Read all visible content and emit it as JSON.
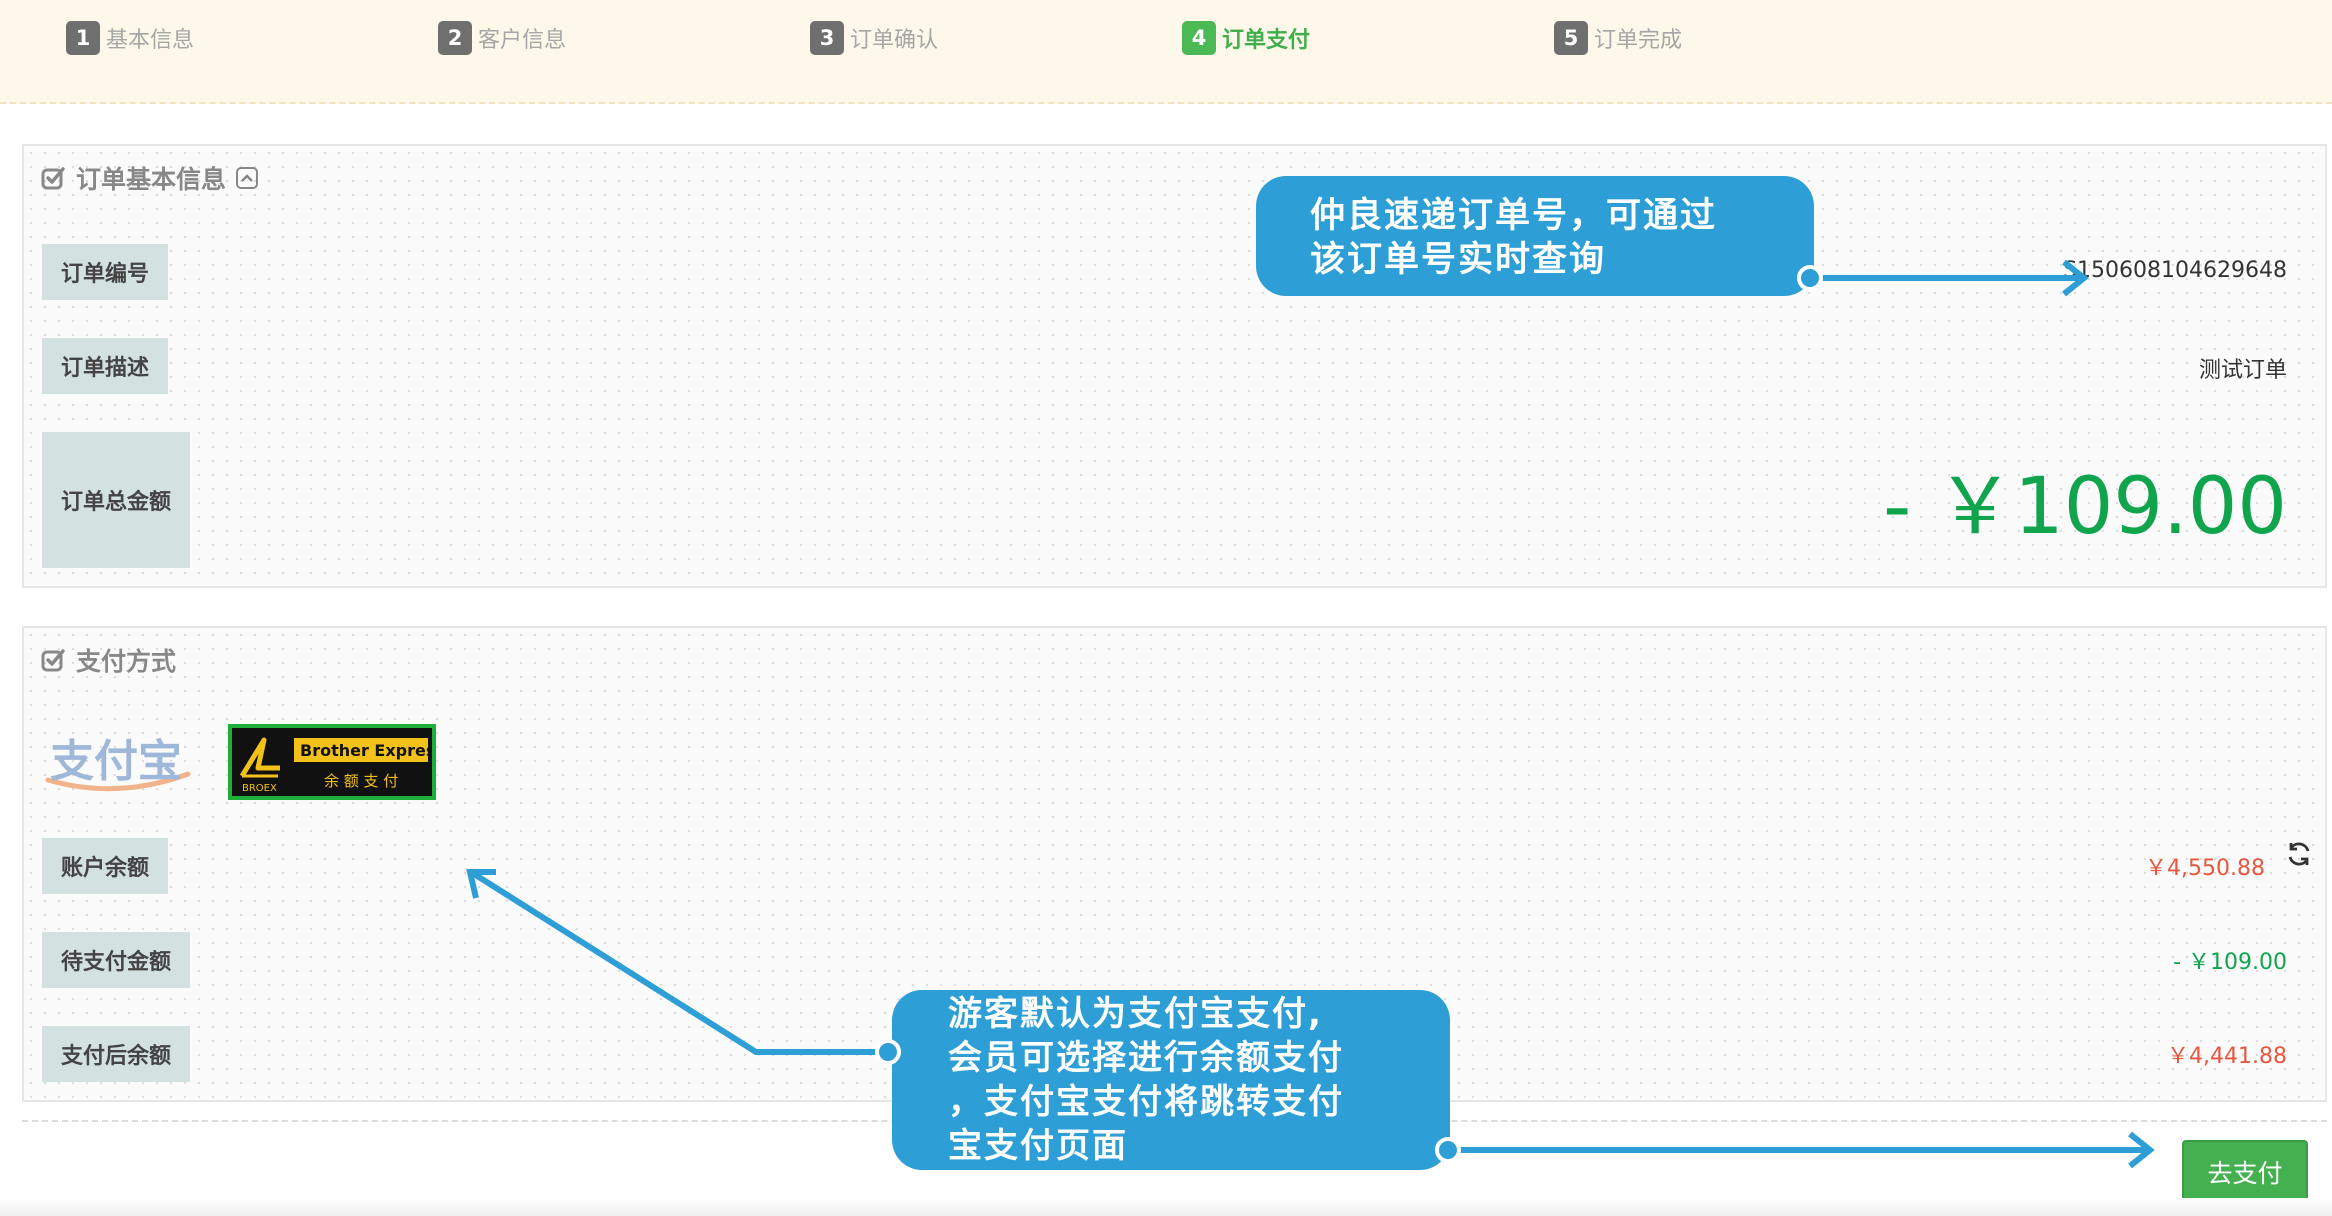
{
  "steps": [
    {
      "num": "1",
      "label": "基本信息",
      "active": false
    },
    {
      "num": "2",
      "label": "客户信息",
      "active": false
    },
    {
      "num": "3",
      "label": "订单确认",
      "active": false
    },
    {
      "num": "4",
      "label": "订单支付",
      "active": true
    },
    {
      "num": "5",
      "label": "订单完成",
      "active": false
    }
  ],
  "order_info": {
    "title": "订单基本信息",
    "order_no_label": "订单编号",
    "order_no": "S150608104629648",
    "desc_label": "订单描述",
    "desc": "测试订单",
    "total_label": "订单总金额",
    "total": "- ￥109.00"
  },
  "payment": {
    "title": "支付方式",
    "alipay_logo_text": "支付宝",
    "brother_logo": {
      "brand": "Brother Express",
      "sub": "余 额 支 付",
      "mark": "BROEX"
    },
    "balance_label": "账户余额",
    "balance": "￥4,550.88",
    "pending_label": "待支付金额",
    "pending": "- ￥109.00",
    "after_label": "支付后余额",
    "after": "￥4,441.88",
    "pay_button": "去支付"
  },
  "annotations": {
    "top": "仲良速递订单号，可通过\n该订单号实时查询",
    "bottom": "游客默认为支付宝支付,\n会员可选择进行余额支付\n，支付宝支付将跳转支付\n宝支付页面"
  },
  "colors": {
    "active_step": "#4cba54",
    "amount_green": "#10a54d",
    "amount_red": "#e5573f",
    "callout_blue": "#2d9fd6",
    "pay_button": "#45b04f"
  }
}
